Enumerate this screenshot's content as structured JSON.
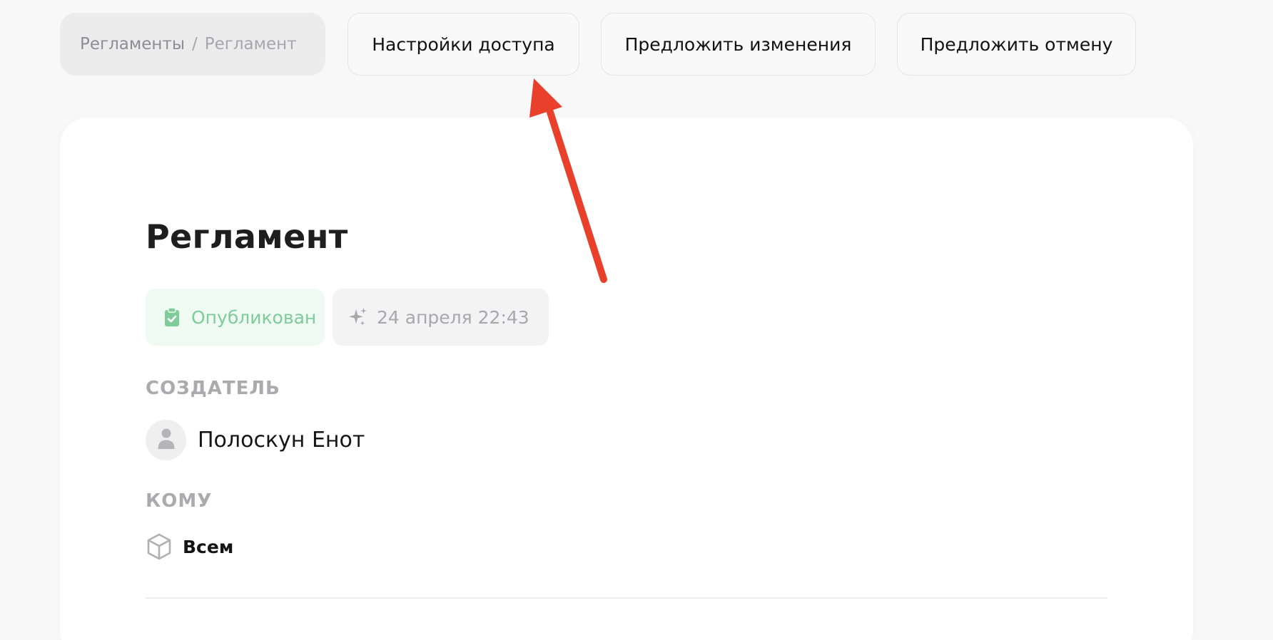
{
  "breadcrumb": {
    "parent": "Регламенты",
    "separator": "/",
    "current": "Регламент"
  },
  "toolbar": {
    "access_settings_label": "Настройки доступа",
    "propose_changes_label": "Предложить изменения",
    "propose_cancel_label": "Предложить отмену"
  },
  "document": {
    "title": "Регламент",
    "status": {
      "label": "Опубликован",
      "icon": "clipboard-check-icon",
      "color": "#7fcb99",
      "background": "#eefaf2"
    },
    "date": {
      "label": "24 апреля 22:43",
      "icon": "sparkles-icon"
    },
    "creator": {
      "heading": "СОЗДАТЕЛЬ",
      "name": "Полоскун Енот",
      "avatar_icon": "user-icon"
    },
    "audience": {
      "heading": "КОМУ",
      "value": "Всем",
      "icon": "cube-icon"
    }
  },
  "annotation": {
    "type": "arrow",
    "color": "#e8402a",
    "points_to": "access-settings-button"
  }
}
